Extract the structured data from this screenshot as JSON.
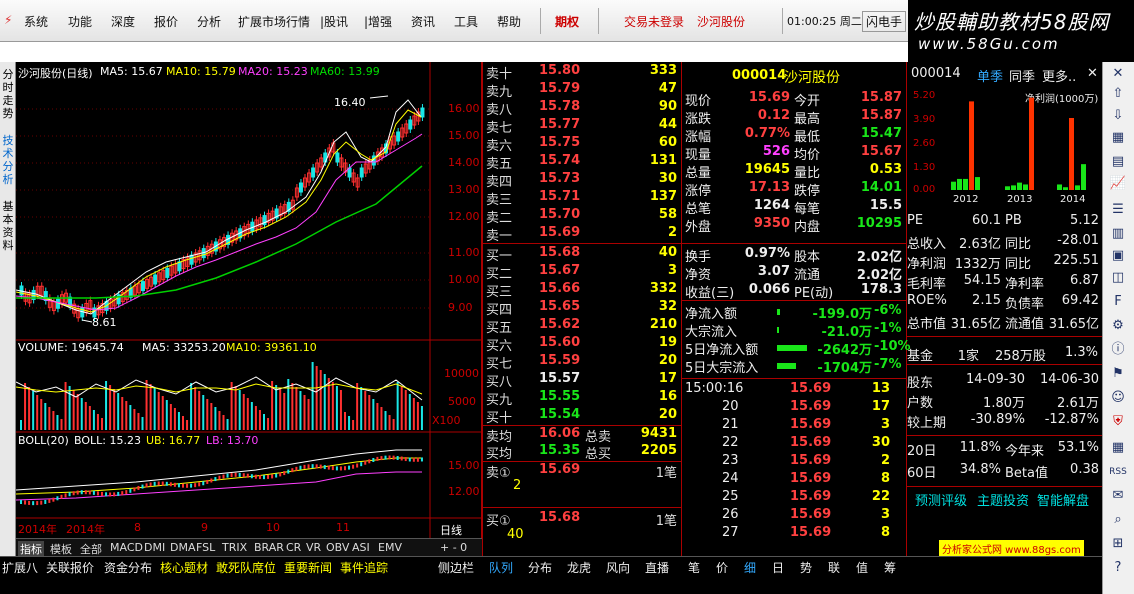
{
  "menu": {
    "items": [
      "系统",
      "功能",
      "深度",
      "报价",
      "分析",
      "扩展市场行情",
      "|股讯",
      "|增强",
      "资讯",
      "工具",
      "帮助"
    ],
    "period": "期权",
    "login": "交易未登录",
    "stock": "沙河股份",
    "time": "01:00:25 周二",
    "flash": "闪电手"
  },
  "brand": {
    "line1": "炒股輔助教材58股网",
    "line2": "www.58Gu.com"
  },
  "side_tabs": [
    "分时走势",
    "技术分析",
    "基本资料"
  ],
  "kline": {
    "title": "沙河股份(日线)",
    "ma5": "MA5: 15.67",
    "ma10": "MA10: 15.79",
    "ma20": "MA20: 15.23",
    "ma60": "MA60: 13.99",
    "high_label": "16.40",
    "low_label": "8.61",
    "yticks": [
      "16.00",
      "15.00",
      "14.00",
      "13.00",
      "12.00",
      "11.00",
      "10.00",
      "9.00"
    ],
    "volume": {
      "title": "VOLUME: 19645.74",
      "ma5": "MA5: 33253.20",
      "ma10": "MA10: 39361.10",
      "yticks": [
        "10000",
        "5000",
        "X100"
      ]
    },
    "boll": {
      "title": "BOLL(20)",
      "boll": "BOLL: 15.23",
      "ub": "UB: 16.77",
      "lb": "LB: 13.70",
      "yticks": [
        "15.00",
        "12.00"
      ]
    },
    "dates": [
      "2014年",
      "8",
      "9",
      "10",
      "11"
    ],
    "period_label": "日线",
    "zoom": "+ - 0"
  },
  "indicator_tabs": [
    "指标",
    "模板",
    "全部",
    "MACD",
    "DMI",
    "DMA",
    "FSL",
    "TRIX",
    "BRAR",
    "CR",
    "VR",
    "OBV",
    "ASI",
    "EMV"
  ],
  "orderbook": {
    "asks": [
      {
        "n": "卖十",
        "p": "15.80",
        "v": "333"
      },
      {
        "n": "卖九",
        "p": "15.79",
        "v": "47"
      },
      {
        "n": "卖八",
        "p": "15.78",
        "v": "90"
      },
      {
        "n": "卖七",
        "p": "15.77",
        "v": "44"
      },
      {
        "n": "卖六",
        "p": "15.75",
        "v": "60"
      },
      {
        "n": "卖五",
        "p": "15.74",
        "v": "131"
      },
      {
        "n": "卖四",
        "p": "15.73",
        "v": "30"
      },
      {
        "n": "卖三",
        "p": "15.71",
        "v": "137"
      },
      {
        "n": "卖二",
        "p": "15.70",
        "v": "58"
      },
      {
        "n": "卖一",
        "p": "15.69",
        "v": "2"
      }
    ],
    "bids": [
      {
        "n": "买一",
        "p": "15.68",
        "v": "40"
      },
      {
        "n": "买二",
        "p": "15.67",
        "v": "3"
      },
      {
        "n": "买三",
        "p": "15.66",
        "v": "332"
      },
      {
        "n": "买四",
        "p": "15.65",
        "v": "32"
      },
      {
        "n": "买五",
        "p": "15.62",
        "v": "210"
      },
      {
        "n": "买六",
        "p": "15.60",
        "v": "19"
      },
      {
        "n": "买七",
        "p": "15.59",
        "v": "20"
      },
      {
        "n": "买八",
        "p": "15.57",
        "v": "17"
      },
      {
        "n": "买九",
        "p": "15.55",
        "v": "16"
      },
      {
        "n": "买十",
        "p": "15.54",
        "v": "20"
      }
    ],
    "ask_avg": {
      "n": "卖均",
      "p": "16.06",
      "l": "总卖",
      "v": "9431"
    },
    "bid_avg": {
      "n": "买均",
      "p": "15.35",
      "l": "总买",
      "v": "2205"
    },
    "queue_sell": {
      "n": "卖①",
      "p": "15.69",
      "c": "1笔",
      "q": "2"
    },
    "queue_buy": {
      "n": "买①",
      "p": "15.68",
      "c": "1笔",
      "q": "40"
    },
    "tabs": [
      "队列",
      "分布",
      "龙虎",
      "风向",
      "直播"
    ]
  },
  "quote": {
    "code": "000014",
    "name": "沙河股份",
    "rows": [
      [
        "现价",
        "15.69",
        "今开",
        "15.87"
      ],
      [
        "涨跌",
        "0.12",
        "最高",
        "15.87"
      ],
      [
        "涨幅",
        "0.77%",
        "最低",
        "15.47"
      ],
      [
        "现量",
        "526",
        "均价",
        "15.67"
      ],
      [
        "总量",
        "19645",
        "量比",
        "0.53"
      ],
      [
        "涨停",
        "17.13",
        "跌停",
        "14.01"
      ],
      [
        "总笔",
        "1264",
        "每笔",
        "15.5"
      ],
      [
        "外盘",
        "9350",
        "内盘",
        "10295"
      ]
    ],
    "rows2": [
      [
        "换手",
        "0.97%",
        "股本",
        "2.02亿"
      ],
      [
        "净资",
        "3.07",
        "流通",
        "2.02亿"
      ],
      [
        "收益(三)",
        "0.066",
        "PE(动)",
        "178.3"
      ]
    ],
    "flows": [
      [
        "净流入额",
        "-199.0万",
        "-6%"
      ],
      [
        "大宗流入",
        "-21.0万",
        "-1%"
      ],
      [
        "5日净流入额",
        "-2642万",
        "-10%"
      ],
      [
        "5日大宗流入",
        "-1704万",
        "-7%"
      ]
    ],
    "ticks": [
      [
        "15:00:16",
        "15.69",
        "13"
      ],
      [
        "20",
        "15.69",
        "17"
      ],
      [
        "21",
        "15.69",
        "3"
      ],
      [
        "22",
        "15.69",
        "30"
      ],
      [
        "23",
        "15.69",
        "2"
      ],
      [
        "24",
        "15.69",
        "8"
      ],
      [
        "25",
        "15.69",
        "22"
      ],
      [
        "26",
        "15.69",
        "3"
      ],
      [
        "27",
        "15.69",
        "8"
      ]
    ],
    "tabs": [
      "笔",
      "价",
      "细",
      "日",
      "势",
      "联",
      "值",
      "筹"
    ]
  },
  "fin": {
    "code": "000014",
    "tab1": "单季",
    "tab2": "同季",
    "more": "更多..",
    "chart_label": "净利润(1000万)",
    "yticks": [
      "5.20",
      "3.90",
      "2.60",
      "1.30",
      "0.00"
    ],
    "years": [
      "2012",
      "2013",
      "2014"
    ],
    "rows": [
      [
        "PE",
        "60.1",
        "PB",
        "5.12"
      ],
      [
        "总收入",
        "2.63亿",
        "同比",
        "-28.01"
      ],
      [
        "净利润",
        "1332万",
        "同比",
        "225.51"
      ],
      [
        "毛利率",
        "54.15",
        "净利率",
        "6.87"
      ],
      [
        "ROE%",
        "2.15",
        "负债率",
        "69.42"
      ],
      [
        "总市值",
        "31.65亿",
        "流通值",
        "31.65亿"
      ]
    ],
    "fund": [
      "基金",
      "1家",
      "258万股",
      "1.3%"
    ],
    "holders": [
      [
        "股东",
        "14-09-30",
        "14-06-30"
      ],
      [
        "户数",
        "1.80万",
        "2.61万"
      ],
      [
        "较上期",
        "-30.89%",
        "-12.87%"
      ]
    ],
    "perf": [
      [
        "20日",
        "11.8%",
        "今年来",
        "53.1%"
      ],
      [
        "60日",
        "34.8%",
        "Beta值",
        "0.38"
      ]
    ],
    "links": [
      "预测评级",
      "主题投资",
      "智能解盘"
    ],
    "watermark": "分析家公式网 www.88gs.com"
  },
  "statusbar": [
    "扩展八",
    "关联报价",
    "资金分布",
    "核心题材",
    "敢死队席位",
    "重要新闻",
    "事件追踪",
    "侧边栏"
  ]
}
